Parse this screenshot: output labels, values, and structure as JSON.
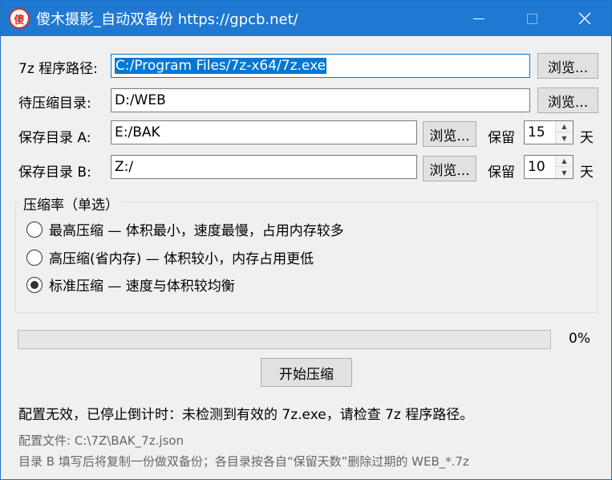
{
  "window": {
    "logo_text": "傻",
    "title": "傻木摄影_自动双备份  https://gpcb.net/",
    "minimize": "—",
    "maximize": "",
    "close": "✕"
  },
  "rows": {
    "sevenz_label": "7z 程序路径:",
    "sevenz_value": "C:/Program Files/7z-x64/7z.exe",
    "source_label": "待压缩目录:",
    "source_value": "D:/WEB",
    "dest_a_label": "保存目录 A:",
    "dest_a_value": "E:/BAK",
    "dest_b_label": "保存目录 B:",
    "dest_b_value": "Z:/",
    "browse_label": "浏览...",
    "keep_label": "保留",
    "days_label": "天",
    "keep_a_days": "15",
    "keep_b_days": "10"
  },
  "compression": {
    "group_title": "压缩率（单选）",
    "options": [
      {
        "label": "最高压缩  —  体积最小，速度最慢，占用内存较多",
        "selected": false
      },
      {
        "label": "高压缩(省内存)  —  体积较小，内存占用更低",
        "selected": false
      },
      {
        "label": "标准压缩  —  速度与体积较均衡",
        "selected": true
      }
    ]
  },
  "progress": {
    "value": 0,
    "percent_text": "0%"
  },
  "actions": {
    "start_label": "开始压缩"
  },
  "status": {
    "message": "配置无效，已停止倒计时：未检测到有效的 7z.exe，请检查 7z 程序路径。",
    "config_file": "配置文件:  C:\\7Z\\BAK_7z.json",
    "hint": "目录 B 填写后将复制一份做双备份；各目录按各自“保留天数”删除过期的 WEB_*.7z"
  },
  "colors": {
    "titlebar": "#1f78d1",
    "selection": "#0078d7",
    "logo": "#d4302a"
  }
}
